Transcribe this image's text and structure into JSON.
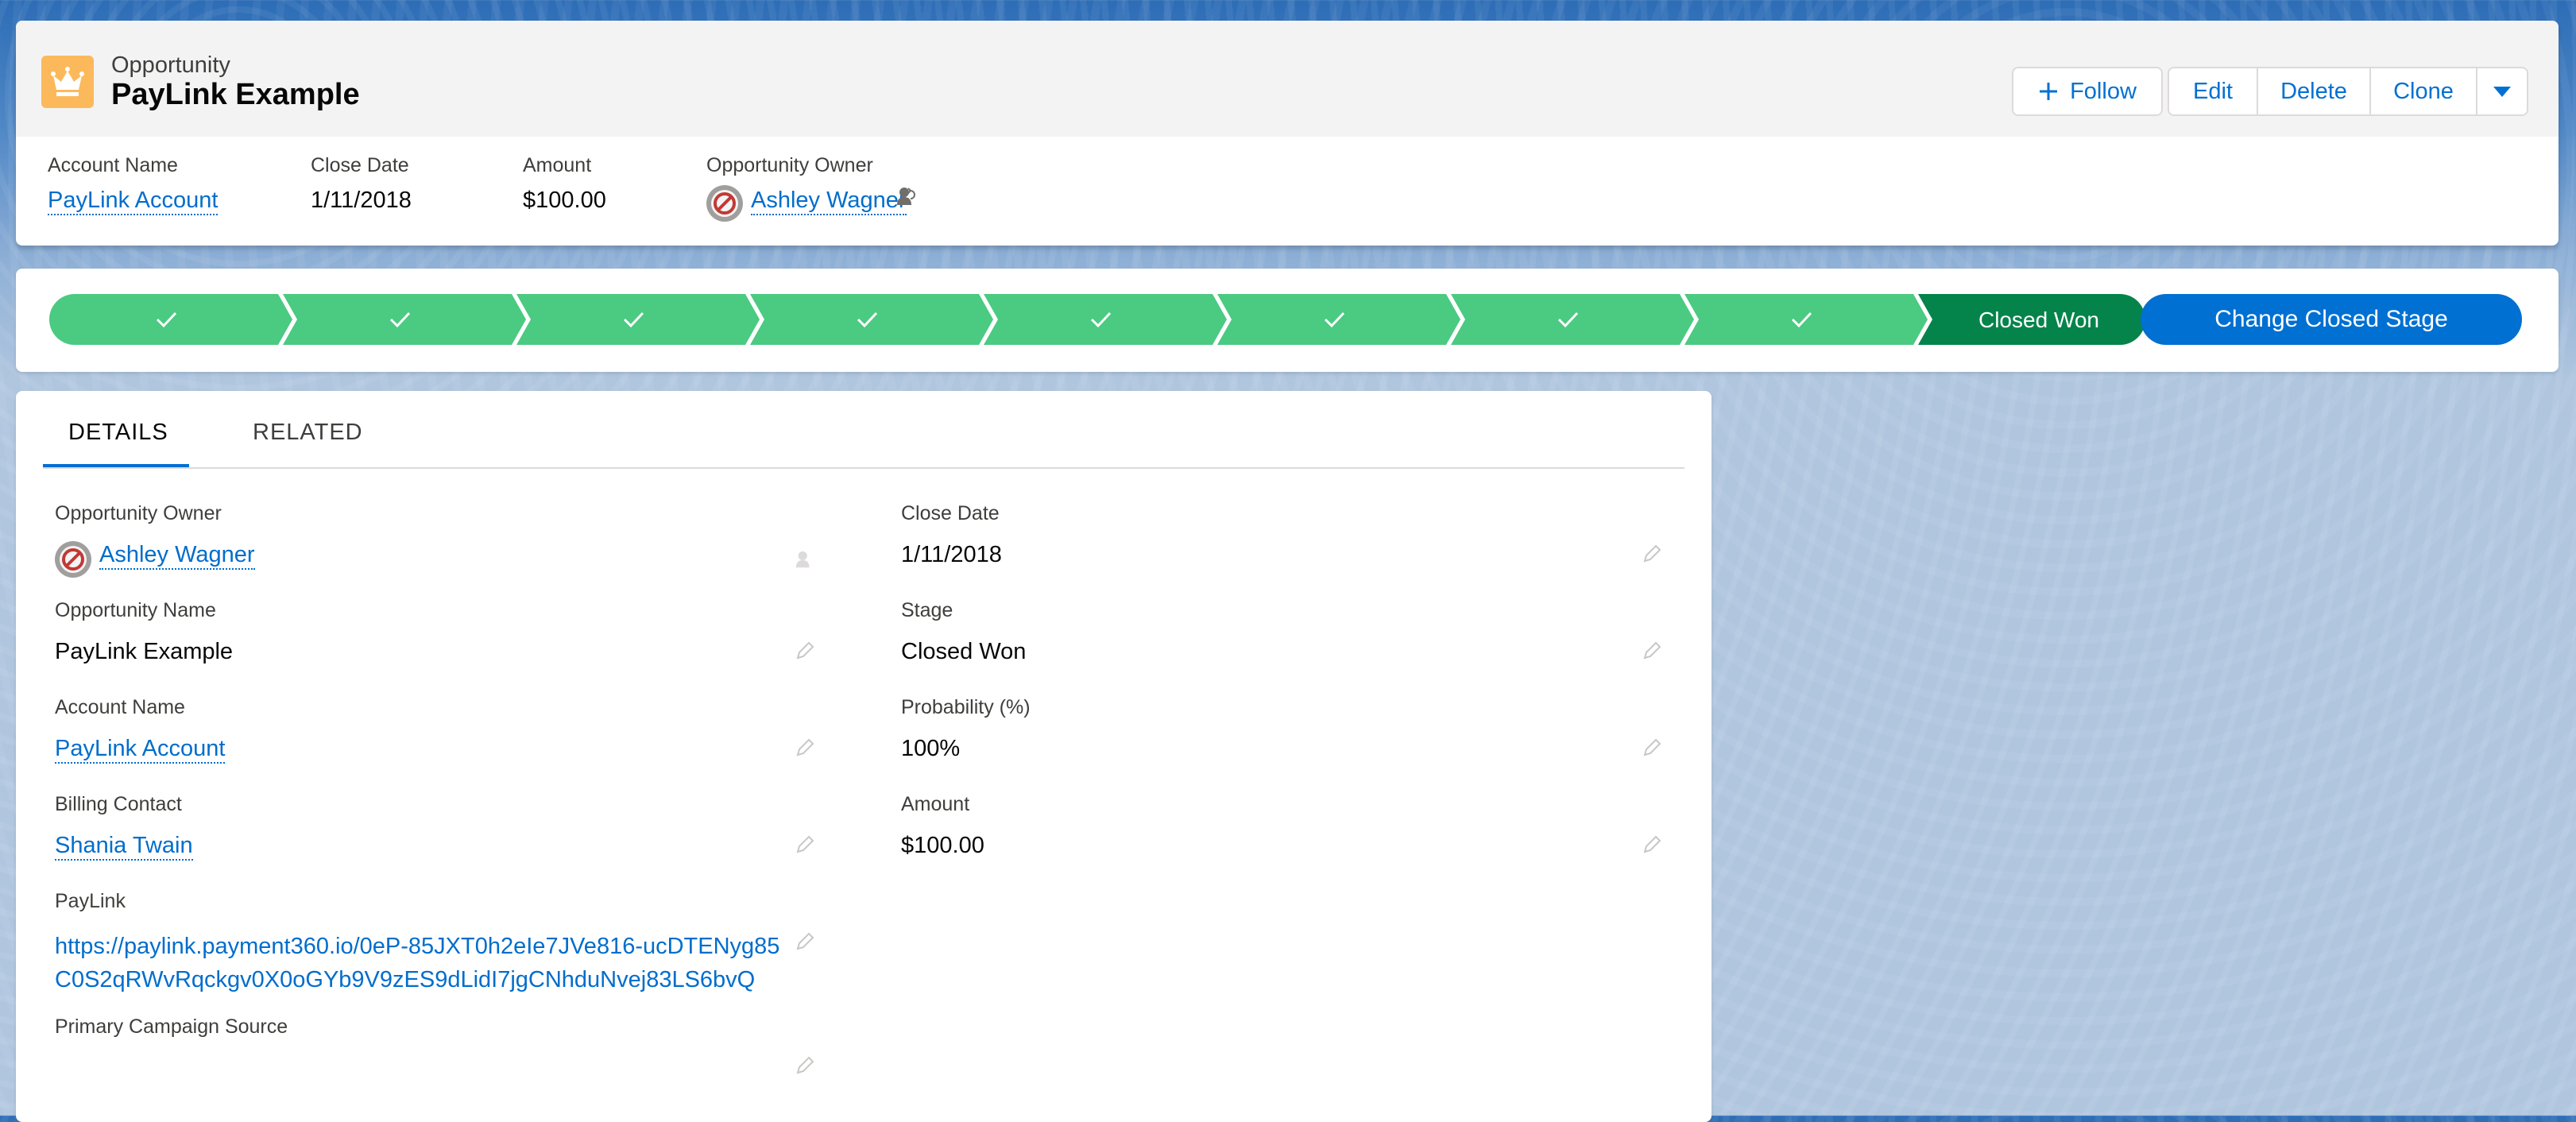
{
  "record": {
    "object_label": "Opportunity",
    "title": "PayLink Example"
  },
  "actions": {
    "follow": "Follow",
    "edit": "Edit",
    "delete": "Delete",
    "clone": "Clone"
  },
  "highlights": {
    "account_label": "Account Name",
    "account_value": "PayLink Account",
    "close_label": "Close Date",
    "close_value": "1/11/2018",
    "amount_label": "Amount",
    "amount_value": "$100.00",
    "owner_label": "Opportunity Owner",
    "owner_value": "Ashley Wagner"
  },
  "path": {
    "completed_steps": 8,
    "current_stage": "Closed Won",
    "action_label": "Change Closed Stage",
    "complete_color": "#4bca81",
    "current_color": "#04844b"
  },
  "tabs": {
    "details": "DETAILS",
    "related": "RELATED"
  },
  "fields": {
    "owner_label": "Opportunity Owner",
    "owner_value": "Ashley Wagner",
    "close_label": "Close Date",
    "close_value": "1/11/2018",
    "name_label": "Opportunity Name",
    "name_value": "PayLink Example",
    "stage_label": "Stage",
    "stage_value": "Closed Won",
    "account_label": "Account Name",
    "account_value": "PayLink Account",
    "prob_label": "Probability (%)",
    "prob_value": "100%",
    "billing_label": "Billing Contact",
    "billing_value": "Shania Twain",
    "amount_label": "Amount",
    "amount_value": "$100.00",
    "paylink_label": "PayLink",
    "paylink_value": "https://paylink.payment360.io/0eP-85JXT0h2eIe7JVe816-ucDTENyg85C0S2qRWvRqckgv0X0oGYb9V9zES9dLidI7jgCNhduNvej83LS6bvQ",
    "campaign_label": "Primary Campaign Source"
  },
  "colors": {
    "brand_blue": "#0070d2",
    "link_blue": "#006dcc",
    "opportunity_icon": "#fcb95b"
  },
  "icons": [
    "crown-icon",
    "plus-icon",
    "chevron-down-icon",
    "check-icon",
    "pencil-icon",
    "change-owner-icon"
  ]
}
